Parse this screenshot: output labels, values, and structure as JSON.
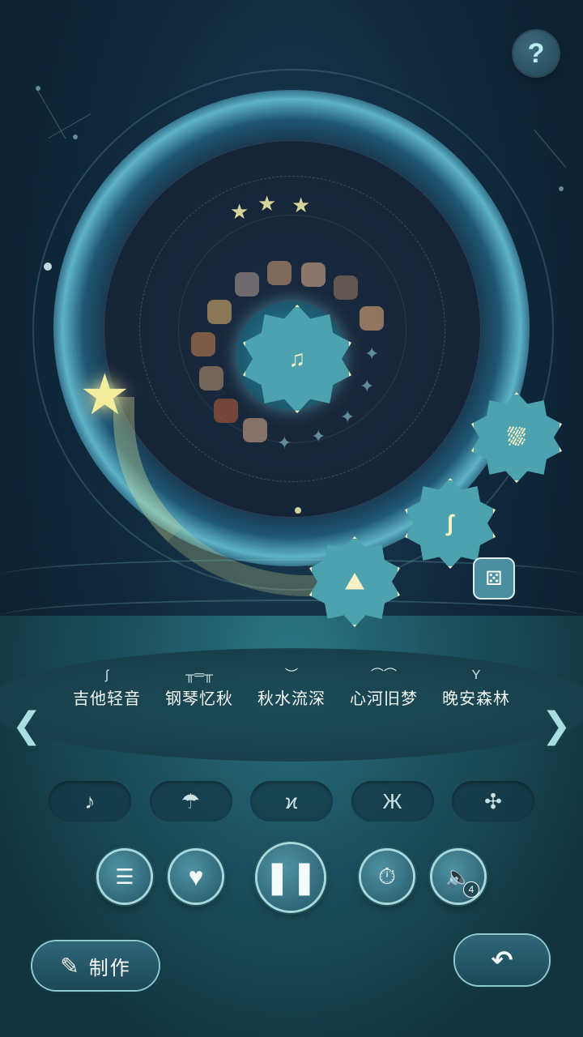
{
  "help": {
    "label": "?"
  },
  "record": {
    "center_badge_icon": "badge-music-icon",
    "stars": [
      "★",
      "★",
      "★"
    ]
  },
  "badges": [
    {
      "icon": "seasonal-ii-icon",
      "glyph": "⛆"
    },
    {
      "icon": "river-ii-icon",
      "glyph": "∫"
    },
    {
      "icon": "forest-ii-icon",
      "glyph": "⛰"
    }
  ],
  "dice": {
    "glyph": "⚄"
  },
  "tracks": [
    {
      "name": "吉他轻音",
      "icon": "guitar-icon",
      "glyph": "ʃ"
    },
    {
      "name": "钢琴忆秋",
      "icon": "piano-icon",
      "glyph": "╥═╥"
    },
    {
      "name": "秋水流深",
      "icon": "water-icon",
      "glyph": "︶"
    },
    {
      "name": "心河旧梦",
      "icon": "bridge-icon",
      "glyph": "⌒⌒"
    },
    {
      "name": "晚安森林",
      "icon": "tree-icon",
      "glyph": "Y"
    }
  ],
  "nav": {
    "left": "❮",
    "right": "❯"
  },
  "categories": [
    {
      "icon": "music-note-icon",
      "glyph": "♪"
    },
    {
      "icon": "rain-icon",
      "glyph": "☂"
    },
    {
      "icon": "grass-icon",
      "glyph": "ϰ"
    },
    {
      "icon": "butterfly-icon",
      "glyph": "Ж"
    },
    {
      "icon": "pinwheel-icon",
      "glyph": "✣"
    }
  ],
  "controls": {
    "playlist_glyph": "☰",
    "heart_glyph": "♥",
    "pause_glyph": "❚❚",
    "timer_glyph": "⏱",
    "volume_glyph": "🔈",
    "volume_count": "4"
  },
  "make_button": {
    "label": "制作",
    "glyph": "✎"
  },
  "back_button": {
    "glyph": "↶"
  }
}
